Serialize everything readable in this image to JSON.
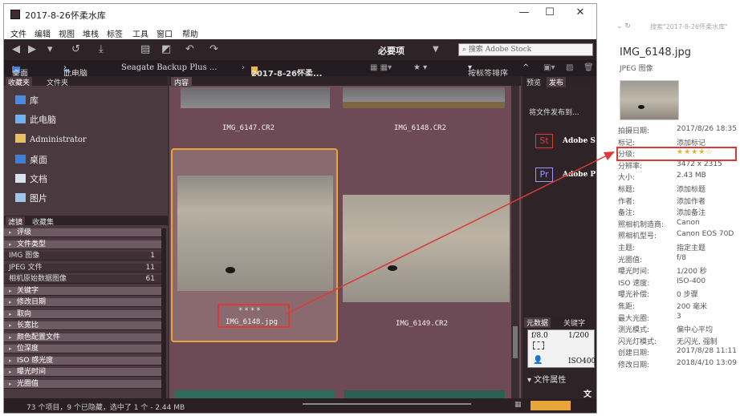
{
  "window": {
    "title": "2017-8-26怀柔水库",
    "controls": [
      "—",
      "☐",
      "✕"
    ]
  },
  "menu": [
    "文件",
    "编辑",
    "视图",
    "堆栈",
    "标签",
    "工具",
    "窗口",
    "帮助"
  ],
  "toolbar": {
    "workspace": "必要项",
    "search_placeholder": "搜索 Adobe Stock"
  },
  "path": {
    "items": [
      "桌面",
      "此电脑",
      "Seagate Backup Plus ...",
      "2017-8-26怀柔..."
    ],
    "sort_label": "按标签排序"
  },
  "left_panel": {
    "tabs": [
      "收藏夹",
      "文件夹"
    ],
    "favorites": [
      {
        "label": "库",
        "icon": "library-icon"
      },
      {
        "label": "此电脑",
        "icon": "computer-icon"
      },
      {
        "label": "Administrator",
        "icon": "user-folder-icon"
      },
      {
        "label": "桌面",
        "icon": "desktop-icon"
      },
      {
        "label": "文档",
        "icon": "documents-icon"
      },
      {
        "label": "图片",
        "icon": "pictures-icon"
      }
    ],
    "filter_tabs": [
      "滤镜",
      "收藏集"
    ],
    "filters": [
      {
        "label": "评级",
        "count": "",
        "type": "header"
      },
      {
        "label": "文件类型",
        "count": "",
        "type": "header"
      },
      {
        "label": "IMG 图像",
        "count": "1",
        "type": "item"
      },
      {
        "label": "JPEG 文件",
        "count": "11",
        "type": "item"
      },
      {
        "label": "相机原始数据图像",
        "count": "61",
        "type": "item"
      },
      {
        "label": "关键字",
        "count": "",
        "type": "header"
      },
      {
        "label": "修改日期",
        "count": "",
        "type": "header"
      },
      {
        "label": "取向",
        "count": "",
        "type": "header"
      },
      {
        "label": "长宽比",
        "count": "",
        "type": "header"
      },
      {
        "label": "颜色配置文件",
        "count": "",
        "type": "header"
      },
      {
        "label": "位深度",
        "count": "",
        "type": "header"
      },
      {
        "label": "ISO 感光度",
        "count": "",
        "type": "header"
      },
      {
        "label": "曝光时间",
        "count": "",
        "type": "header"
      },
      {
        "label": "光圈值",
        "count": "",
        "type": "header"
      }
    ]
  },
  "content": {
    "tab": "内容",
    "thumbnails": [
      {
        "name": "IMG_6147.CR2",
        "rating": "",
        "selected": false
      },
      {
        "name": "IMG_6148.CR2",
        "rating": "",
        "selected": false
      },
      {
        "name": "IMG_6148.jpg",
        "rating": "****",
        "selected": true
      },
      {
        "name": "IMG_6149.CR2",
        "rating": "",
        "selected": false
      }
    ]
  },
  "right_panel": {
    "tabs": [
      "预览",
      "发布"
    ],
    "publish_text": "将文件发布到...",
    "services": [
      {
        "code": "St",
        "name": "Adobe S",
        "color": "#e03a3e"
      },
      {
        "code": "Pr",
        "name": "Adobe P",
        "color": "#9999ff"
      }
    ],
    "meta_tabs": [
      "元数据",
      "关键字"
    ],
    "camera": {
      "aperture": "f/8.0",
      "shutter": "1/200",
      "iso": "ISO400"
    },
    "file_props_label": "文件属性",
    "file_props_value": "文件"
  },
  "status": {
    "text": "73 个项目，9 个已隐藏，选中了 1 个 - 2.44 MB"
  },
  "metadata_panel": {
    "explorer_search": "搜索\"2017-8-26怀柔水库\"",
    "file_name": "IMG_6148.jpg",
    "file_type": "JPEG 图像",
    "rating_stars": 4,
    "rows": [
      {
        "key": "拍摄日期:",
        "value": "2017/8/26 18:35"
      },
      {
        "key": "标记:",
        "value": "添加标记"
      },
      {
        "key": "分级:",
        "value": "★★★★☆"
      },
      {
        "key": "分辨率:",
        "value": "3472 x 2315"
      },
      {
        "key": "大小:",
        "value": "2.43 MB"
      },
      {
        "key": "标题:",
        "value": "添加标题"
      },
      {
        "key": "作者:",
        "value": "添加作者"
      },
      {
        "key": "备注:",
        "value": "添加备注"
      },
      {
        "key": "照相机制造商:",
        "value": "Canon"
      },
      {
        "key": "照相机型号:",
        "value": "Canon EOS 70D"
      },
      {
        "key": "主题:",
        "value": "指定主题"
      },
      {
        "key": "光圈值:",
        "value": "f/8"
      },
      {
        "key": "曝光时间:",
        "value": "1/200 秒"
      },
      {
        "key": "ISO 速度:",
        "value": "ISO-400"
      },
      {
        "key": "曝光补偿:",
        "value": "0 步骤"
      },
      {
        "key": "焦距:",
        "value": "200 毫米"
      },
      {
        "key": "最大光圈:",
        "value": "3"
      },
      {
        "key": "测光模式:",
        "value": "偏中心平均"
      },
      {
        "key": "闪光灯模式:",
        "value": "无闪光, 强制"
      },
      {
        "key": "创建日期:",
        "value": "2017/8/28 11:11"
      },
      {
        "key": "修改日期:",
        "value": "2018/4/10 13:09"
      }
    ]
  },
  "colors": {
    "annotation": "#d93a3a",
    "selection": "#e8a53a",
    "content_bg": "#6e4a56"
  }
}
